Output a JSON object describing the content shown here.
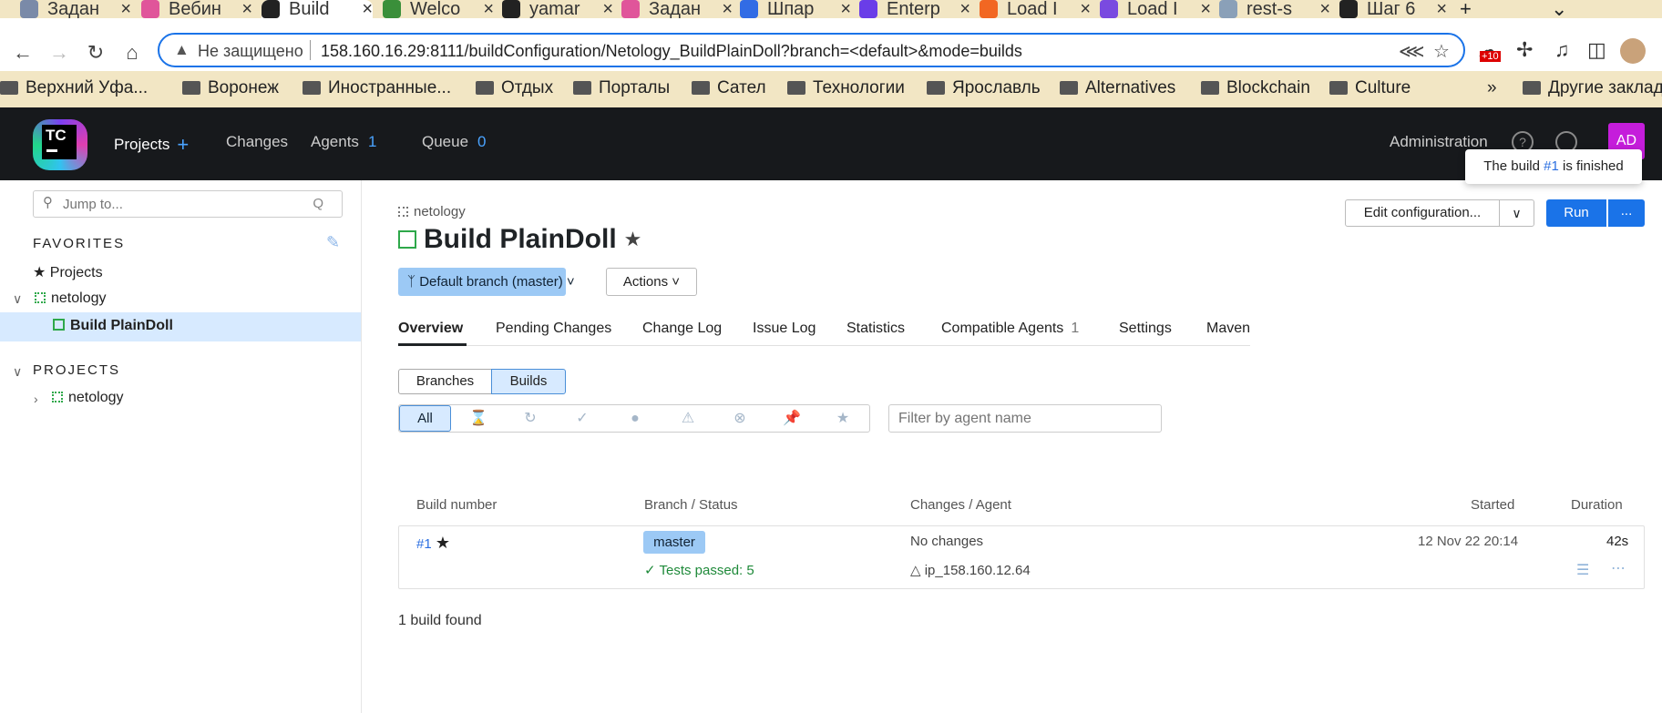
{
  "browser": {
    "tabs": [
      {
        "label": "Задан",
        "color": "#7a8aa8"
      },
      {
        "label": "Вебин",
        "color": "#e0559a"
      },
      {
        "label": "Build",
        "color": "#222222"
      },
      {
        "label": "Welco",
        "color": "#3a8f3a"
      },
      {
        "label": "yamar",
        "color": "#222222"
      },
      {
        "label": "Задан",
        "color": "#e0559a"
      },
      {
        "label": "Шпар",
        "color": "#326ce5"
      },
      {
        "label": "Enterp",
        "color": "#6a3de8"
      },
      {
        "label": "Load I",
        "color": "#f26722"
      },
      {
        "label": "Load I",
        "color": "#7a4ae0"
      },
      {
        "label": "rest-s",
        "color": "#8aa0b8"
      },
      {
        "label": "Шаг 6",
        "color": "#222222"
      }
    ],
    "address": {
      "insecure_label": "Не защищено",
      "url": "158.160.16.29:8111/buildConfiguration/Netology_BuildPlainDoll?branch=<default>&mode=builds"
    },
    "ext_badge": "+10",
    "bookmarks": [
      "Верхний Уфа...",
      "Воронеж",
      "Иностранные...",
      "Отдых",
      "Порталы",
      "Сател",
      "Технологии",
      "Ярославль",
      "Alternatives",
      "Blockchain",
      "Culture"
    ],
    "bookmarks_more": "»",
    "other_bookmarks": "Другие заклад"
  },
  "header": {
    "logo_text": "TC",
    "projects": "Projects",
    "changes": "Changes",
    "agents": "Agents",
    "agents_count": "1",
    "queue": "Queue",
    "queue_count": "0",
    "administration": "Administration",
    "help": "?",
    "user_initials": "AD",
    "tooltip_prefix": "The build",
    "tooltip_num": "#1",
    "tooltip_suffix": "is finished"
  },
  "sidebar": {
    "jump_placeholder": "Jump to...",
    "jump_hotkey": "Q",
    "favorites_title": "FAVORITES",
    "fav_projects": "Projects",
    "fav_netology": "netology",
    "fav_build": "Build PlainDoll",
    "projects_title": "PROJECTS",
    "proj_netology": "netology"
  },
  "main": {
    "breadcrumb": "netology",
    "title": "Build PlainDoll",
    "branch_button": "Default branch (master)",
    "actions_button": "Actions",
    "edit_config": "Edit configuration...",
    "run": "Run",
    "run_more": "...",
    "tabs": [
      {
        "label": "Overview"
      },
      {
        "label": "Pending Changes"
      },
      {
        "label": "Change Log"
      },
      {
        "label": "Issue Log"
      },
      {
        "label": "Statistics"
      },
      {
        "label": "Compatible Agents",
        "count": "1"
      },
      {
        "label": "Settings"
      },
      {
        "label": "Maven"
      }
    ],
    "view_branches": "Branches",
    "view_builds": "Builds",
    "filter_all": "All",
    "agent_filter_placeholder": "Filter by agent name",
    "columns": {
      "number": "Build number",
      "branch": "Branch / Status",
      "changes": "Changes / Agent",
      "started": "Started",
      "duration": "Duration"
    },
    "build": {
      "number": "#1",
      "branch": "master",
      "status": "Tests passed: 5",
      "changes": "No changes",
      "agent": "ip_158.160.12.64",
      "started": "12 Nov 22 20:14",
      "duration": "42s"
    },
    "found": "1 build found"
  }
}
